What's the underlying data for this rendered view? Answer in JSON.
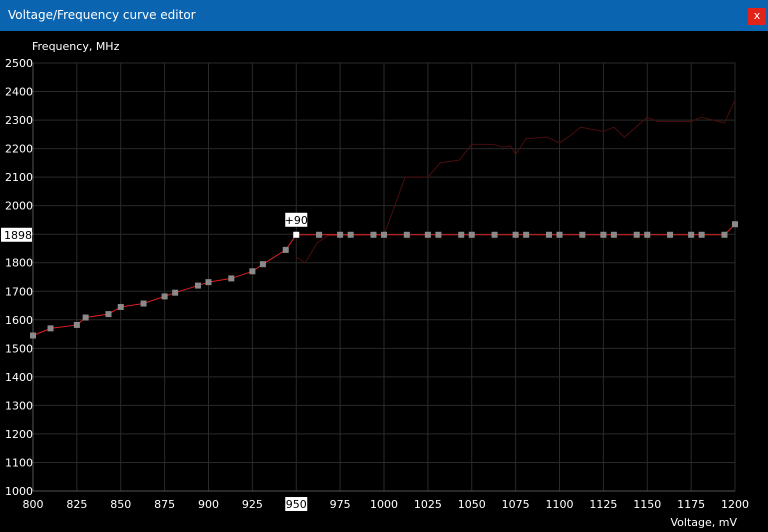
{
  "window": {
    "title": "Voltage/Frequency curve editor",
    "close_label": "x"
  },
  "chart_data": {
    "type": "line",
    "ylabel": "Frequency, MHz",
    "xlabel": "Voltage, mV",
    "xlim": [
      800,
      1200
    ],
    "ylim": [
      1000,
      2500
    ],
    "x_ticks": [
      800,
      825,
      850,
      875,
      900,
      925,
      950,
      975,
      1000,
      1025,
      1050,
      1075,
      1100,
      1125,
      1150,
      1175,
      1200
    ],
    "y_ticks": [
      1000,
      1100,
      1200,
      1300,
      1400,
      1500,
      1600,
      1700,
      1800,
      1900,
      2000,
      2100,
      2200,
      2300,
      2400,
      2500
    ],
    "grid": true,
    "selected_point": {
      "voltage": 950,
      "frequency": 1898,
      "offset_label": "+90",
      "x_highlight": "950",
      "y_highlight": "1898"
    },
    "series": [
      {
        "values": [
          [
            800,
            1545
          ],
          [
            810,
            1570
          ],
          [
            825,
            1582
          ],
          [
            830,
            1608
          ],
          [
            843,
            1620
          ],
          [
            850,
            1645
          ],
          [
            863,
            1657
          ],
          [
            875,
            1682
          ],
          [
            881,
            1695
          ],
          [
            894,
            1720
          ],
          [
            900,
            1732
          ],
          [
            913,
            1745
          ],
          [
            925,
            1770
          ],
          [
            931,
            1795
          ],
          [
            944,
            1845
          ],
          [
            950,
            1898
          ],
          [
            963,
            1898
          ],
          [
            975,
            1898
          ],
          [
            981,
            1898
          ],
          [
            994,
            1898
          ],
          [
            1000,
            1898
          ],
          [
            1013,
            1898
          ],
          [
            1025,
            1898
          ],
          [
            1031,
            1898
          ],
          [
            1044,
            1898
          ],
          [
            1050,
            1898
          ],
          [
            1063,
            1898
          ],
          [
            1075,
            1898
          ],
          [
            1081,
            1898
          ],
          [
            1094,
            1898
          ],
          [
            1100,
            1898
          ],
          [
            1113,
            1898
          ],
          [
            1125,
            1898
          ],
          [
            1131,
            1898
          ],
          [
            1144,
            1898
          ],
          [
            1150,
            1898
          ],
          [
            1163,
            1898
          ],
          [
            1175,
            1898
          ],
          [
            1181,
            1898
          ],
          [
            1194,
            1898
          ],
          [
            1200,
            1935
          ]
        ],
        "color": "#e02020"
      },
      {
        "values": [
          [
            950,
            1820
          ],
          [
            955,
            1800
          ],
          [
            962,
            1870
          ],
          [
            968,
            1895
          ],
          [
            1000,
            1898
          ],
          [
            1005,
            1980
          ],
          [
            1012,
            2100
          ],
          [
            1025,
            2100
          ],
          [
            1032,
            2150
          ],
          [
            1043,
            2160
          ],
          [
            1050,
            2215
          ],
          [
            1062,
            2215
          ],
          [
            1068,
            2205
          ],
          [
            1072,
            2210
          ],
          [
            1075,
            2180
          ],
          [
            1081,
            2235
          ],
          [
            1093,
            2240
          ],
          [
            1100,
            2220
          ],
          [
            1106,
            2245
          ],
          [
            1112,
            2275
          ],
          [
            1125,
            2260
          ],
          [
            1131,
            2275
          ],
          [
            1137,
            2240
          ],
          [
            1150,
            2310
          ],
          [
            1156,
            2295
          ],
          [
            1175,
            2295
          ],
          [
            1181,
            2310
          ],
          [
            1194,
            2290
          ],
          [
            1200,
            2370
          ]
        ],
        "color": "#4a0d0d"
      }
    ]
  }
}
